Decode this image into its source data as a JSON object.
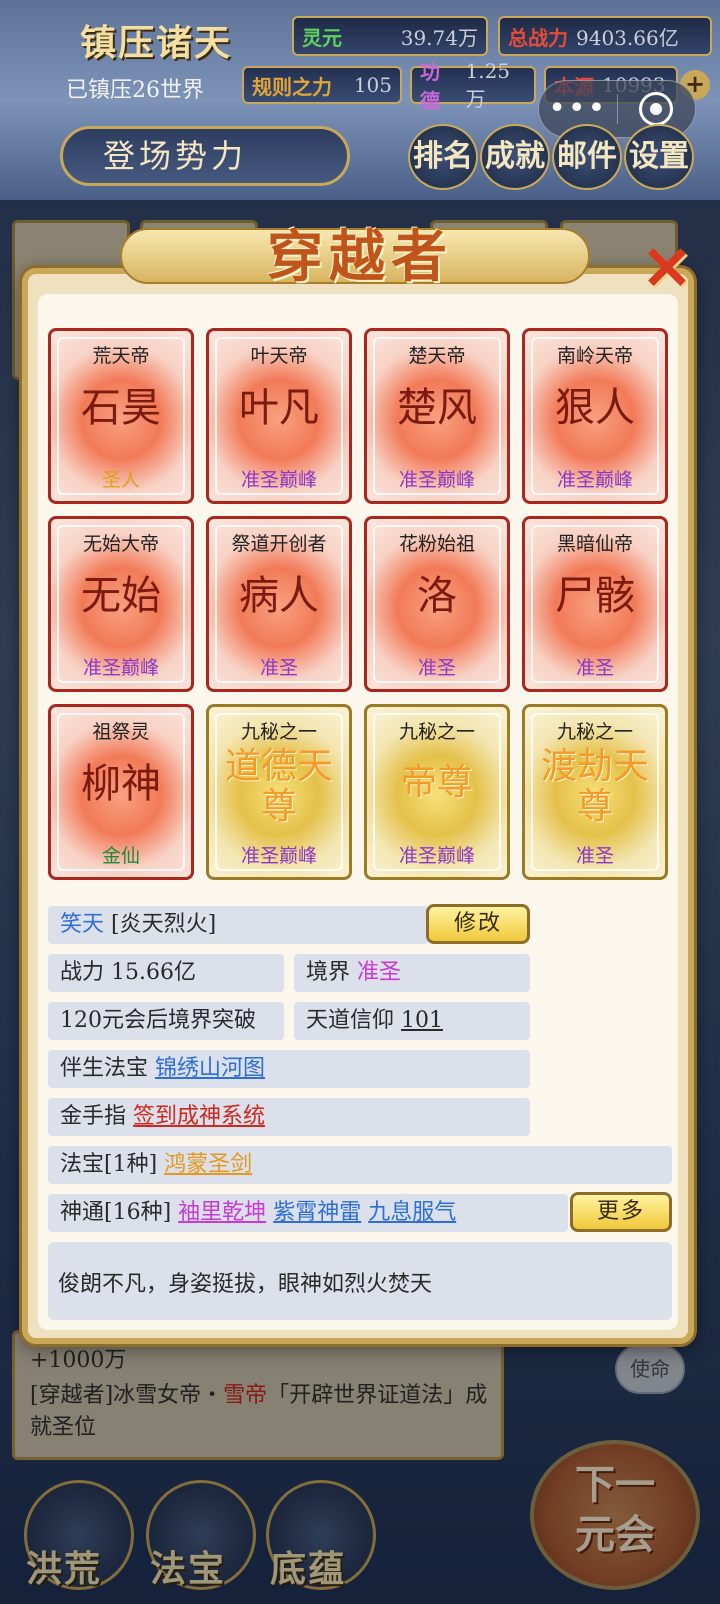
{
  "hud": {
    "title": "镇压诸天",
    "lingyuan_label": "灵元",
    "lingyuan_value": "39.74万",
    "power_label": "总战力",
    "power_value": "9403.66亿",
    "subtitle": "已镇压26世界",
    "rule_label": "规则之力",
    "rule_value": "105",
    "merit_label": "功德",
    "merit_value": "1.25万",
    "source_label": "本源",
    "source_value": "10993",
    "plus": "+",
    "force_button": "登场势力",
    "nav": [
      "排名",
      "成就",
      "邮件",
      "设置"
    ]
  },
  "miniprogram": {
    "more": "•••"
  },
  "modal": {
    "title": "穿越者",
    "close": "✕",
    "cards": [
      {
        "title": "荒天帝",
        "name": "石昊",
        "rank": "圣人",
        "style": "red",
        "rank_color": "gold"
      },
      {
        "title": "叶天帝",
        "name": "叶凡",
        "rank": "准圣巅峰",
        "style": "red",
        "rank_color": "purple"
      },
      {
        "title": "楚天帝",
        "name": "楚风",
        "rank": "准圣巅峰",
        "style": "red",
        "rank_color": "purple"
      },
      {
        "title": "南岭天帝",
        "name": "狠人",
        "rank": "准圣巅峰",
        "style": "red",
        "rank_color": "purple"
      },
      {
        "title": "无始大帝",
        "name": "无始",
        "rank": "准圣巅峰",
        "style": "red",
        "rank_color": "purple"
      },
      {
        "title": "祭道开创者",
        "name": "病人",
        "rank": "准圣",
        "style": "red",
        "rank_color": "purple"
      },
      {
        "title": "花粉始祖",
        "name": "洛",
        "rank": "准圣",
        "style": "red",
        "rank_color": "purple"
      },
      {
        "title": "黑暗仙帝",
        "name": "尸骸",
        "rank": "准圣",
        "style": "red",
        "rank_color": "purple"
      },
      {
        "title": "祖祭灵",
        "name": "柳神",
        "rank": "金仙",
        "style": "red",
        "rank_color": "green"
      },
      {
        "title": "九秘之一",
        "name": "道德天尊",
        "rank": "准圣巅峰",
        "style": "gold",
        "rank_color": "purple"
      },
      {
        "title": "九秘之一",
        "name": "帝尊",
        "rank": "准圣巅峰",
        "style": "gold",
        "rank_color": "purple"
      },
      {
        "title": "九秘之一",
        "name": "渡劫天尊",
        "rank": "准圣",
        "style": "gold",
        "rank_color": "purple"
      }
    ],
    "profile": {
      "name": "笑天",
      "epithet": "[炎天烈火]",
      "edit_button": "修改",
      "power_label": "战力",
      "power_value": "15.66亿",
      "realm_label": "境界",
      "realm_value": "准圣",
      "breakthrough": "120元会后境界突破",
      "faith_label": "天道信仰",
      "faith_value": "101",
      "treasure_label": "伴生法宝",
      "treasure_value": "锦绣山河图",
      "cheat_label": "金手指",
      "cheat_value": "签到成神系统",
      "artifacts_label": "法宝[1种]",
      "artifacts": [
        "鸿蒙圣剑"
      ],
      "skills_label": "神通[16种]",
      "skills": [
        "袖里乾坤",
        "紫霄神雷",
        "九息服气"
      ],
      "more_button": "更多",
      "description": "俊朗不凡，身姿挺拔，眼神如烈火焚天"
    }
  },
  "background": {
    "log_amount": "+1000万",
    "log_prefix": "[穿越者]冰雪女帝・",
    "log_name": "雪帝",
    "log_suffix": "「开辟世界证道法」成就圣位",
    "mission": "使命",
    "next_button": "下一元会",
    "bottom_nav": [
      "洪荒",
      "法宝",
      "底蕴"
    ]
  }
}
